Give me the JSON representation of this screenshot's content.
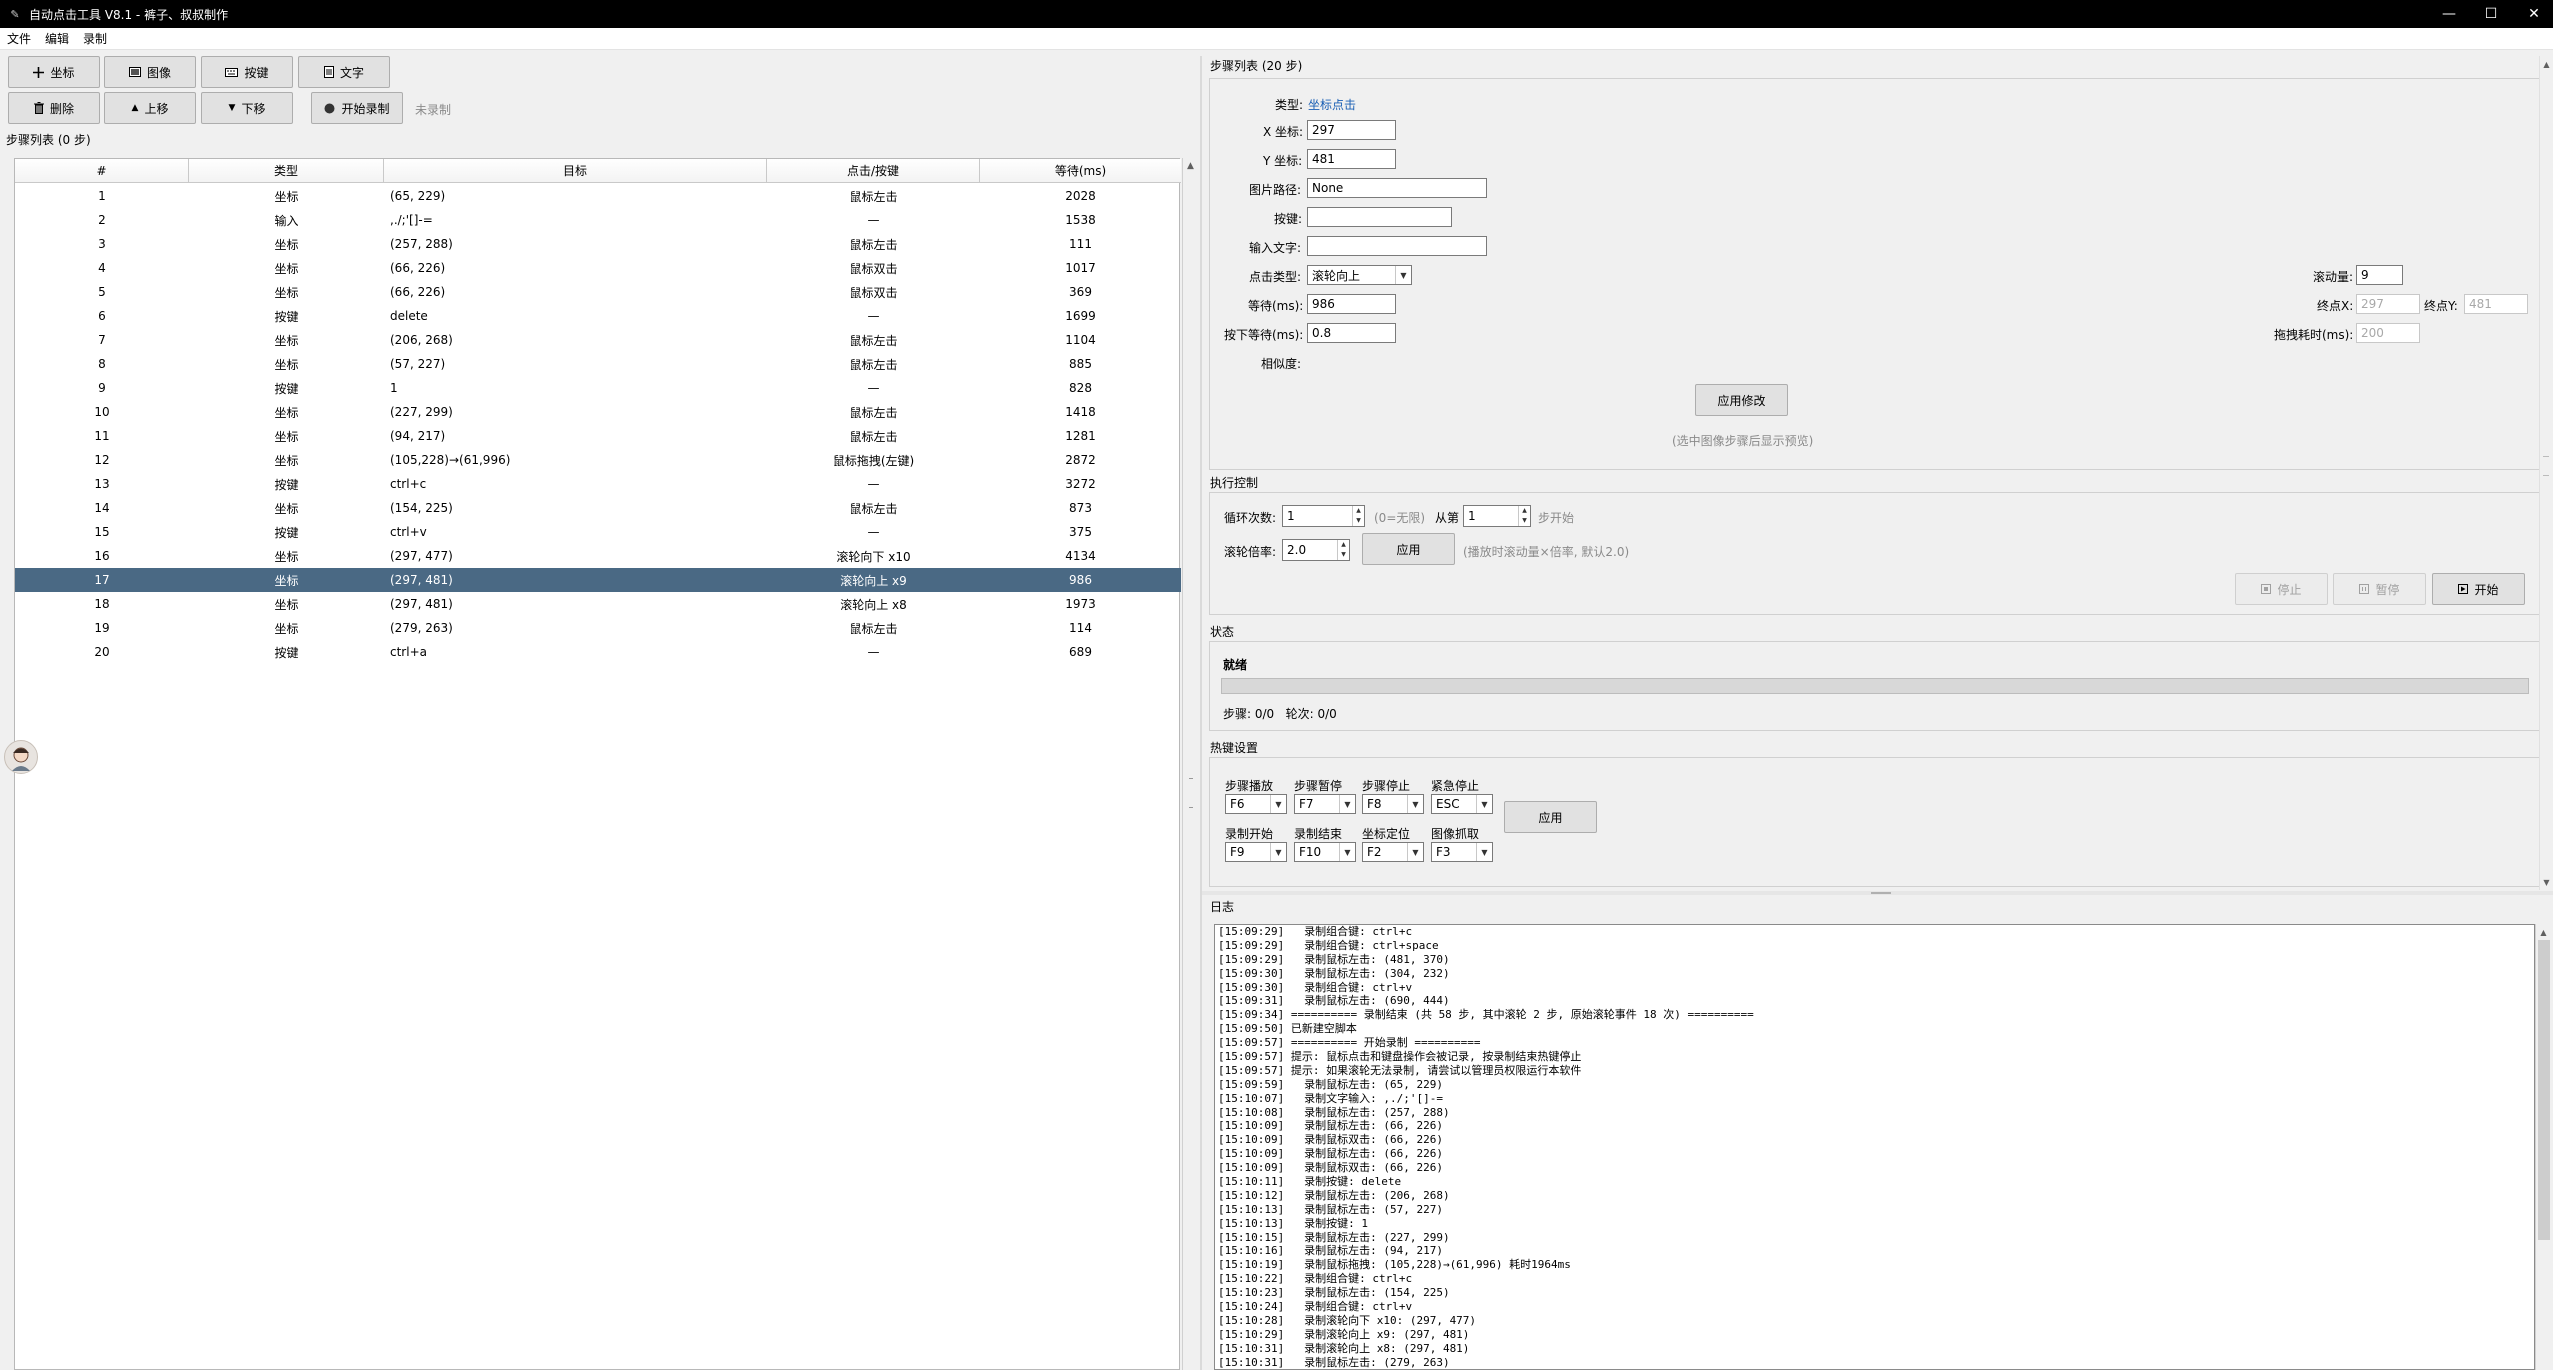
{
  "window": {
    "title": "自动点击工具 V8.1 - 裤子、叔叔制作",
    "min": "—",
    "max": "☐",
    "close": "✕"
  },
  "menu": [
    "文件",
    "编辑",
    "录制"
  ],
  "toolbar": {
    "coord": "坐标",
    "image": "图像",
    "key": "按键",
    "text": "文字",
    "delete": "删除",
    "up": "上移",
    "down": "下移",
    "record": "开始录制",
    "record_status": "未录制"
  },
  "steps_header": "步骤列表 (0 步)",
  "table": {
    "columns": [
      "#",
      "类型",
      "目标",
      "点击/按键",
      "等待(ms)"
    ],
    "selected_index": 16,
    "rows": [
      [
        "1",
        "坐标",
        "(65, 229)",
        "鼠标左击",
        "2028"
      ],
      [
        "2",
        "输入",
        ",./;'[]-=",
        "—",
        "1538"
      ],
      [
        "3",
        "坐标",
        "(257, 288)",
        "鼠标左击",
        "111"
      ],
      [
        "4",
        "坐标",
        "(66, 226)",
        "鼠标双击",
        "1017"
      ],
      [
        "5",
        "坐标",
        "(66, 226)",
        "鼠标双击",
        "369"
      ],
      [
        "6",
        "按键",
        "delete",
        "—",
        "1699"
      ],
      [
        "7",
        "坐标",
        "(206, 268)",
        "鼠标左击",
        "1104"
      ],
      [
        "8",
        "坐标",
        "(57, 227)",
        "鼠标左击",
        "885"
      ],
      [
        "9",
        "按键",
        "1",
        "—",
        "828"
      ],
      [
        "10",
        "坐标",
        "(227, 299)",
        "鼠标左击",
        "1418"
      ],
      [
        "11",
        "坐标",
        "(94, 217)",
        "鼠标左击",
        "1281"
      ],
      [
        "12",
        "坐标",
        "(105,228)→(61,996)",
        "鼠标拖拽(左键)",
        "2872"
      ],
      [
        "13",
        "按键",
        "ctrl+c",
        "—",
        "3272"
      ],
      [
        "14",
        "坐标",
        "(154, 225)",
        "鼠标左击",
        "873"
      ],
      [
        "15",
        "按键",
        "ctrl+v",
        "—",
        "375"
      ],
      [
        "16",
        "坐标",
        "(297, 477)",
        "滚轮向下 x10",
        "4134"
      ],
      [
        "17",
        "坐标",
        "(297, 481)",
        "滚轮向上 x9",
        "986"
      ],
      [
        "18",
        "坐标",
        "(297, 481)",
        "滚轮向上 x8",
        "1973"
      ],
      [
        "19",
        "坐标",
        "(279, 263)",
        "鼠标左击",
        "114"
      ],
      [
        "20",
        "按键",
        "ctrl+a",
        "—",
        "689"
      ]
    ]
  },
  "editor": {
    "header": "步骤列表 (20 步)",
    "type_label": "类型:",
    "type_value": "坐标点击",
    "x_label": "X 坐标:",
    "x_value": "297",
    "y_label": "Y 坐标:",
    "y_value": "481",
    "img_label": "图片路径:",
    "img_value": "None",
    "key_label": "按键:",
    "key_value": "",
    "text_label": "输入文字:",
    "text_value": "",
    "click_label": "点击类型:",
    "click_value": "滚轮向上",
    "wait_label": "等待(ms):",
    "wait_value": "986",
    "press_label": "按下等待(ms):",
    "press_value": "0.8",
    "sim_label": "相似度:",
    "scroll_label": "滚动量:",
    "scroll_value": "9",
    "endx_label": "终点X:",
    "endx_value": "297",
    "endy_label": "终点Y:",
    "endy_value": "481",
    "drag_label": "拖拽耗时(ms):",
    "drag_value": "200",
    "apply": "应用修改",
    "hint": "(选中图像步骤后显示预览)"
  },
  "exec": {
    "title": "执行控制",
    "loop_label": "循环次数:",
    "loop_value": "1",
    "loop_hint": "(0=无限)",
    "from_label": "从第",
    "from_value": "1",
    "from_hint": "步开始",
    "scroll_label": "滚轮倍率:",
    "scroll_value": "2.0",
    "apply": "应用",
    "scroll_hint": "(播放时滚动量×倍率, 默认2.0)",
    "stop": "停止",
    "pause": "暂停",
    "start": "开始"
  },
  "status": {
    "title": "状态",
    "state": "就绪",
    "progress": 0,
    "counts": "步骤: 0/0   轮次: 0/0"
  },
  "hotkeys": {
    "title": "热键设置",
    "items": [
      {
        "label": "步骤播放",
        "value": "F6"
      },
      {
        "label": "步骤暂停",
        "value": "F7"
      },
      {
        "label": "步骤停止",
        "value": "F8"
      },
      {
        "label": "紧急停止",
        "value": "ESC"
      },
      {
        "label": "录制开始",
        "value": "F9"
      },
      {
        "label": "录制结束",
        "value": "F10"
      },
      {
        "label": "坐标定位",
        "value": "F2"
      },
      {
        "label": "图像抓取",
        "value": "F3"
      }
    ],
    "apply": "应用"
  },
  "log": {
    "title": "日志",
    "lines": [
      "[15:09:29]   录制组合键: ctrl+c",
      "[15:09:29]   录制组合键: ctrl+space",
      "[15:09:29]   录制鼠标左击: (481, 370)",
      "[15:09:30]   录制鼠标左击: (304, 232)",
      "[15:09:30]   录制组合键: ctrl+v",
      "[15:09:31]   录制鼠标左击: (690, 444)",
      "[15:09:34] ========== 录制结束 (共 58 步, 其中滚轮 2 步, 原始滚轮事件 18 次) ==========",
      "[15:09:50] 已新建空脚本",
      "[15:09:57] ========== 开始录制 ==========",
      "[15:09:57] 提示: 鼠标点击和键盘操作会被记录, 按录制结束热键停止",
      "[15:09:57] 提示: 如果滚轮无法录制, 请尝试以管理员权限运行本软件",
      "[15:09:59]   录制鼠标左击: (65, 229)",
      "[15:10:07]   录制文字输入: ,./;'[]-=",
      "[15:10:08]   录制鼠标左击: (257, 288)",
      "[15:10:09]   录制鼠标左击: (66, 226)",
      "[15:10:09]   录制鼠标双击: (66, 226)",
      "[15:10:09]   录制鼠标左击: (66, 226)",
      "[15:10:09]   录制鼠标双击: (66, 226)",
      "[15:10:11]   录制按键: delete",
      "[15:10:12]   录制鼠标左击: (206, 268)",
      "[15:10:13]   录制鼠标左击: (57, 227)",
      "[15:10:13]   录制按键: 1",
      "[15:10:15]   录制鼠标左击: (227, 299)",
      "[15:10:16]   录制鼠标左击: (94, 217)",
      "[15:10:19]   录制鼠标拖拽: (105,228)→(61,996) 耗时1964ms",
      "[15:10:22]   录制组合键: ctrl+c",
      "[15:10:23]   录制鼠标左击: (154, 225)",
      "[15:10:24]   录制组合键: ctrl+v",
      "[15:10:28]   录制滚轮向下 x10: (297, 477)",
      "[15:10:29]   录制滚轮向上 x9: (297, 481)",
      "[15:10:31]   录制滚轮向上 x8: (297, 481)",
      "[15:10:31]   录制鼠标左击: (279, 263)"
    ]
  },
  "icons": {
    "up_arrow": "▲",
    "down_arrow": "▼",
    "combo_arrow": "▼",
    "spin_up": "▲",
    "spin_down": "▼"
  }
}
